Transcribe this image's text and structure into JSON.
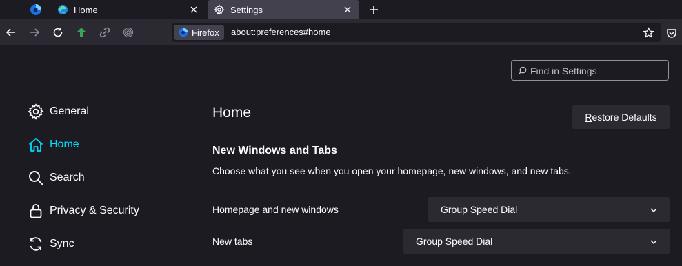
{
  "browser": {
    "tabs": [
      {
        "title": "Home",
        "icon": "edge-icon"
      },
      {
        "title": "Settings",
        "icon": "gear-icon",
        "active": true
      }
    ],
    "urlbar": {
      "identity_label": "Firefox",
      "url": "about:preferences#home"
    }
  },
  "settings": {
    "search_placeholder": "Find in Settings",
    "sidebar": {
      "items": [
        {
          "label": "General",
          "icon": "gear-icon"
        },
        {
          "label": "Home",
          "icon": "home-icon",
          "active": true
        },
        {
          "label": "Search",
          "icon": "search-icon"
        },
        {
          "label": "Privacy & Security",
          "icon": "lock-icon"
        },
        {
          "label": "Sync",
          "icon": "sync-icon"
        }
      ]
    },
    "page_title": "Home",
    "restore_first": "R",
    "restore_rest": "estore Defaults",
    "section": {
      "title": "New Windows and Tabs",
      "description": "Choose what you see when you open your homepage, new windows, and new tabs."
    },
    "rows": [
      {
        "label": "Homepage and new windows",
        "value": "Group Speed Dial"
      },
      {
        "label": "New tabs",
        "value": "Group Speed Dial"
      }
    ]
  },
  "colors": {
    "background": "#1c1b22",
    "toolbar": "#2b2a33",
    "accent": "#00ddff",
    "text": "#fbfbfe"
  }
}
